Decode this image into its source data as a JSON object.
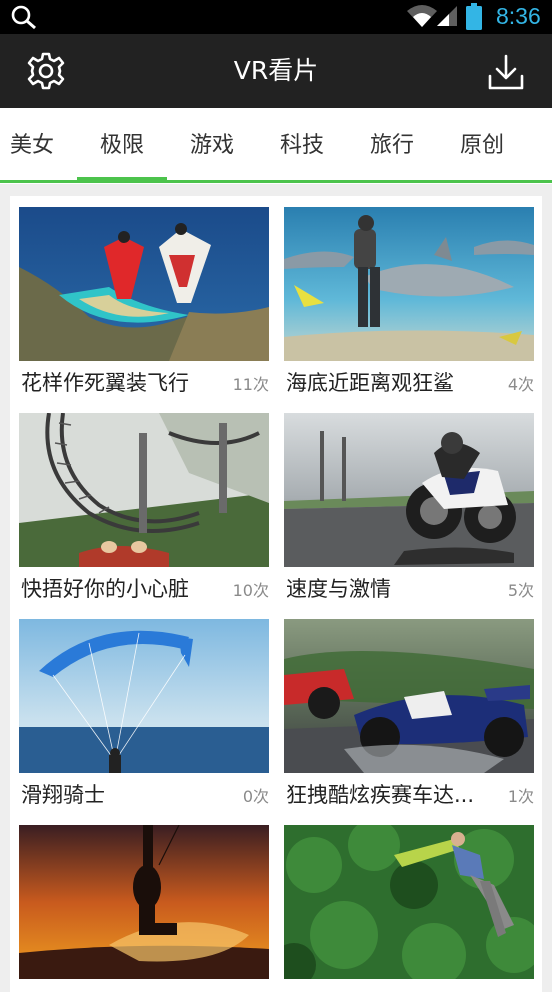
{
  "status_bar": {
    "time": "8:36",
    "icons": [
      "search-icon",
      "wifi-icon",
      "signal-icon",
      "battery-icon"
    ],
    "time_color": "#33b5e5"
  },
  "app_bar": {
    "title": "VR看片",
    "left_icon": "gear-icon",
    "right_icon": "download-icon"
  },
  "tabs": [
    {
      "label": "美女",
      "active": false
    },
    {
      "label": "极限",
      "active": true
    },
    {
      "label": "游戏",
      "active": false
    },
    {
      "label": "科技",
      "active": false
    },
    {
      "label": "旅行",
      "active": false
    },
    {
      "label": "原创",
      "active": false
    }
  ],
  "accent_color": "#4cc34c",
  "videos": [
    {
      "title": "花样作死翼装飞行",
      "count": "11次",
      "thumb": "wingsuit"
    },
    {
      "title": "海底近距离观狂鲨",
      "count": "4次",
      "thumb": "sharks"
    },
    {
      "title": "快捂好你的小心脏",
      "count": "10次",
      "thumb": "rollercoaster"
    },
    {
      "title": "速度与激情",
      "count": "5次",
      "thumb": "motorcycle"
    },
    {
      "title": "滑翔骑士",
      "count": "0次",
      "thumb": "paraglider"
    },
    {
      "title": "狂拽酷炫疾赛车达...",
      "count": "1次",
      "thumb": "formula-car"
    },
    {
      "title": "",
      "count": "",
      "thumb": "kitesurf-sunset"
    },
    {
      "title": "",
      "count": "",
      "thumb": "bungee-jungle"
    }
  ]
}
